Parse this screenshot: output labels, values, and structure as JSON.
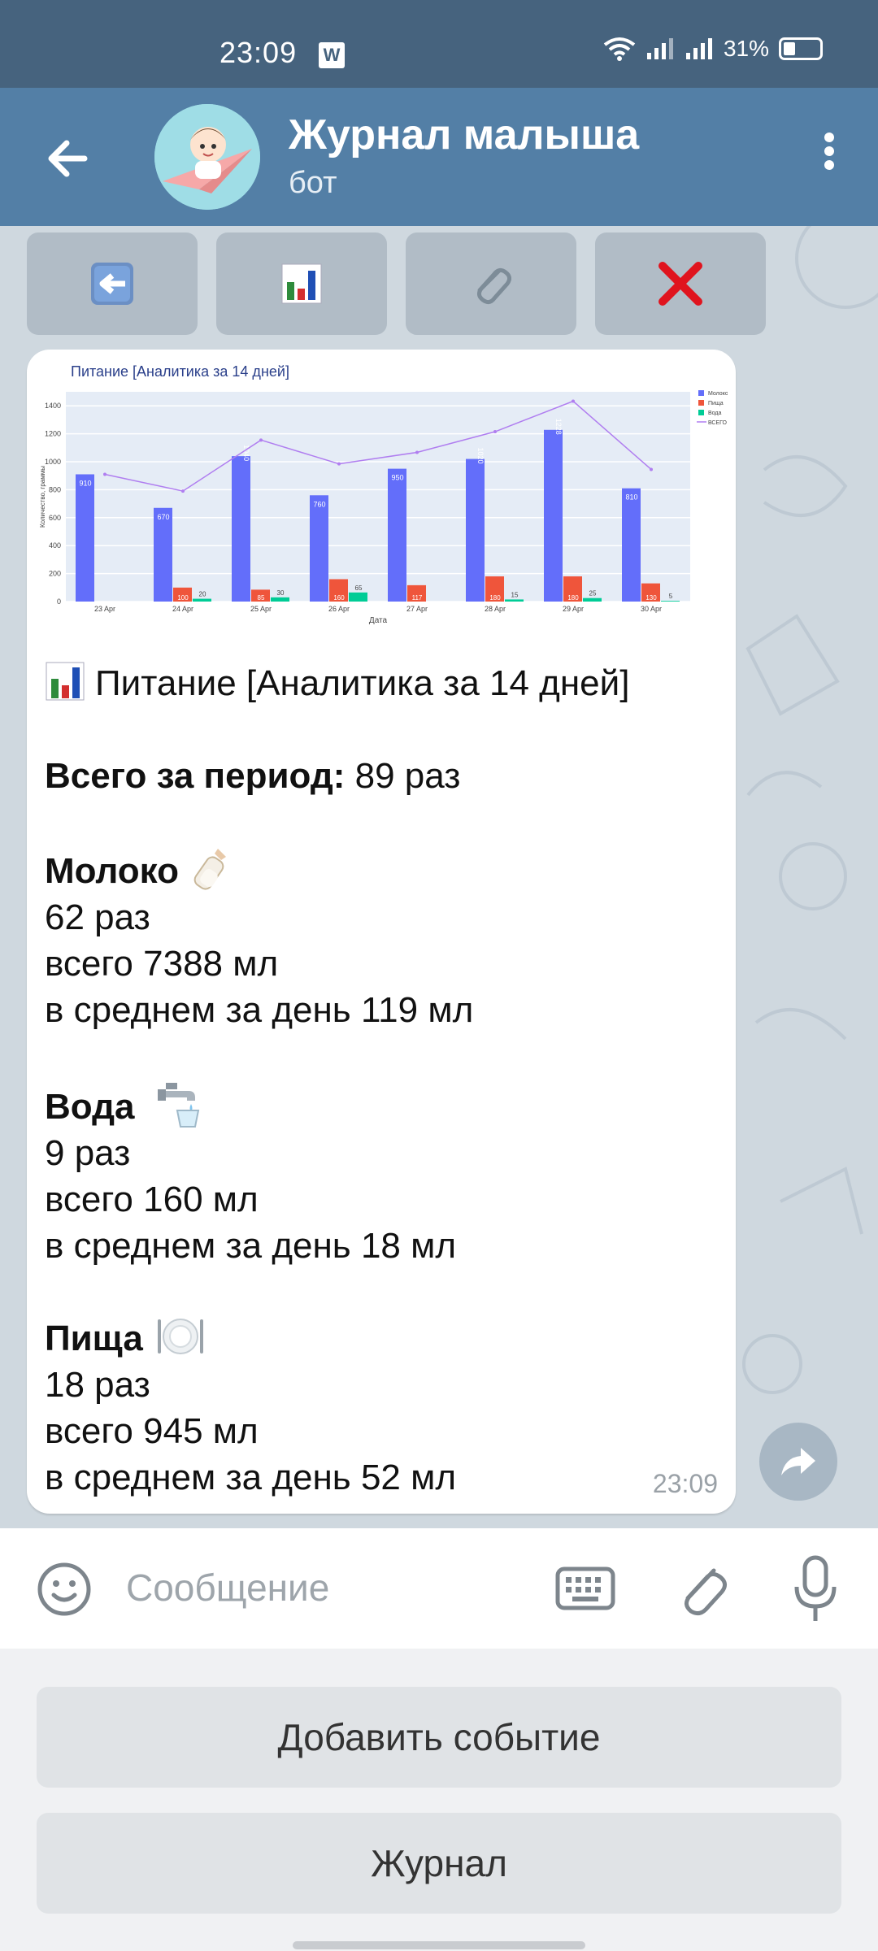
{
  "status_bar": {
    "time": "23:09",
    "battery": "31%"
  },
  "header": {
    "title": "Журнал малыша",
    "subtitle": "бот"
  },
  "inline_buttons": [
    {
      "icon": "back-arrow-icon"
    },
    {
      "icon": "bar-chart-icon"
    },
    {
      "icon": "paperclip-icon"
    },
    {
      "icon": "cross-icon"
    }
  ],
  "colors": {
    "header": "#537fa6",
    "status": "#46637e",
    "milk": "#636efa",
    "food": "#ef553b",
    "water": "#00cc96",
    "total": "#b07ef0"
  },
  "message": {
    "title": "Питание [Аналитика за 14 дней]",
    "total_label": "Всего за период:",
    "total_value": " 89 раз",
    "milk": {
      "name": "Молоко",
      "count": "62 раз",
      "total": "всего 7388 мл",
      "avg": "в среднем за день 119 мл"
    },
    "water": {
      "name": "Вода",
      "count": "9 раз",
      "total": "всего 160 мл",
      "avg": "в среднем за день 18 мл"
    },
    "food": {
      "name": "Пища",
      "count": "18 раз",
      "total": "всего 945 мл",
      "avg": "в среднем за день 52 мл"
    },
    "time": "23:09"
  },
  "input": {
    "placeholder": "Сообщение"
  },
  "reply_keyboard": [
    "Добавить событие",
    "Журнал"
  ],
  "chart_data": {
    "type": "bar",
    "title": "Питание [Аналитика за 14 дней]",
    "xlabel": "Дата",
    "ylabel": "Количество, граммы",
    "categories": [
      "23 Apr",
      "24 Apr",
      "25 Apr",
      "26 Apr",
      "27 Apr",
      "28 Apr",
      "29 Apr",
      "30 Apr"
    ],
    "ylim": [
      0,
      1500
    ],
    "yticks": [
      0,
      200,
      400,
      600,
      800,
      1000,
      1200,
      1400
    ],
    "legend_position": "top-right",
    "series": [
      {
        "name": "Молоко",
        "type": "bar",
        "values": [
          910,
          670,
          1040,
          760,
          950,
          1020,
          1228,
          810
        ],
        "labels": [
          "910",
          "670",
          "1040",
          "760",
          "950",
          "1020",
          "1228",
          "810"
        ]
      },
      {
        "name": "Пища",
        "type": "bar",
        "values": [
          0,
          100,
          85,
          160,
          117,
          180,
          180,
          130
        ],
        "labels": [
          "",
          "100",
          "85",
          "160",
          "117",
          "180",
          "180",
          "130"
        ]
      },
      {
        "name": "Вода",
        "type": "bar",
        "values": [
          0,
          20,
          30,
          65,
          0,
          15,
          25,
          5
        ],
        "labels": [
          "",
          "20",
          "30",
          "65",
          "",
          "15",
          "25",
          "5"
        ]
      },
      {
        "name": "ВСЕГО",
        "type": "line",
        "values": [
          910,
          790,
          1155,
          985,
          1067,
          1215,
          1433,
          945
        ]
      }
    ]
  }
}
